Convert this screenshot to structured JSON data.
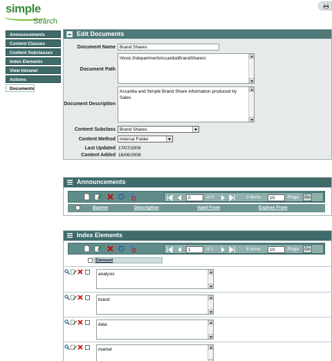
{
  "brand": {
    "word1": "simple",
    "word2": "Search"
  },
  "nav": [
    "Announcements",
    "Content Classes",
    "Content Subclasses",
    "Index Elements",
    "View Intranet",
    "Actions",
    "Documents"
  ],
  "edit": {
    "title": "Edit Documents",
    "document_name_label": "Document Name",
    "document_name": "Brand Shares",
    "document_path_label": "Document Path",
    "document_path": "\\\\host-3\\department\\Accantia\\BrandShares\\",
    "document_description_label": "Document Description",
    "document_description": "Accantia and Simple Brand Share information produced by Sales",
    "content_subclass_label": "Content Subclass",
    "content_subclass": "Brand Shares",
    "content_method_label": "Content Method",
    "content_method": "Internal Folder",
    "last_updated_label": "Last Updated",
    "last_updated": "17/07/2009",
    "content_added_label": "Content Added",
    "content_added": "16/06/2008"
  },
  "ann": {
    "title": "Announcements",
    "page": "0",
    "of": "of 0",
    "items": "0 Items",
    "per": "10",
    "per_label": "/Page",
    "go": "Go",
    "cols": [
      "Banner",
      "Description",
      "Valid From",
      "Expires From"
    ]
  },
  "idx": {
    "title": "Index Elements",
    "page": "1",
    "of": "of 1",
    "items": "8 Items",
    "per": "10",
    "per_label": "/Page",
    "go": "Go",
    "col": "Element",
    "rows": [
      "analysis",
      "brand",
      "data",
      "market"
    ]
  },
  "icons": [
    "print-icon",
    "new-icon",
    "edit-icon",
    "delete-icon",
    "refresh-icon",
    "filter-clear-icon",
    "first-icon",
    "prev-icon",
    "next-icon",
    "last-icon",
    "search-icon"
  ]
}
